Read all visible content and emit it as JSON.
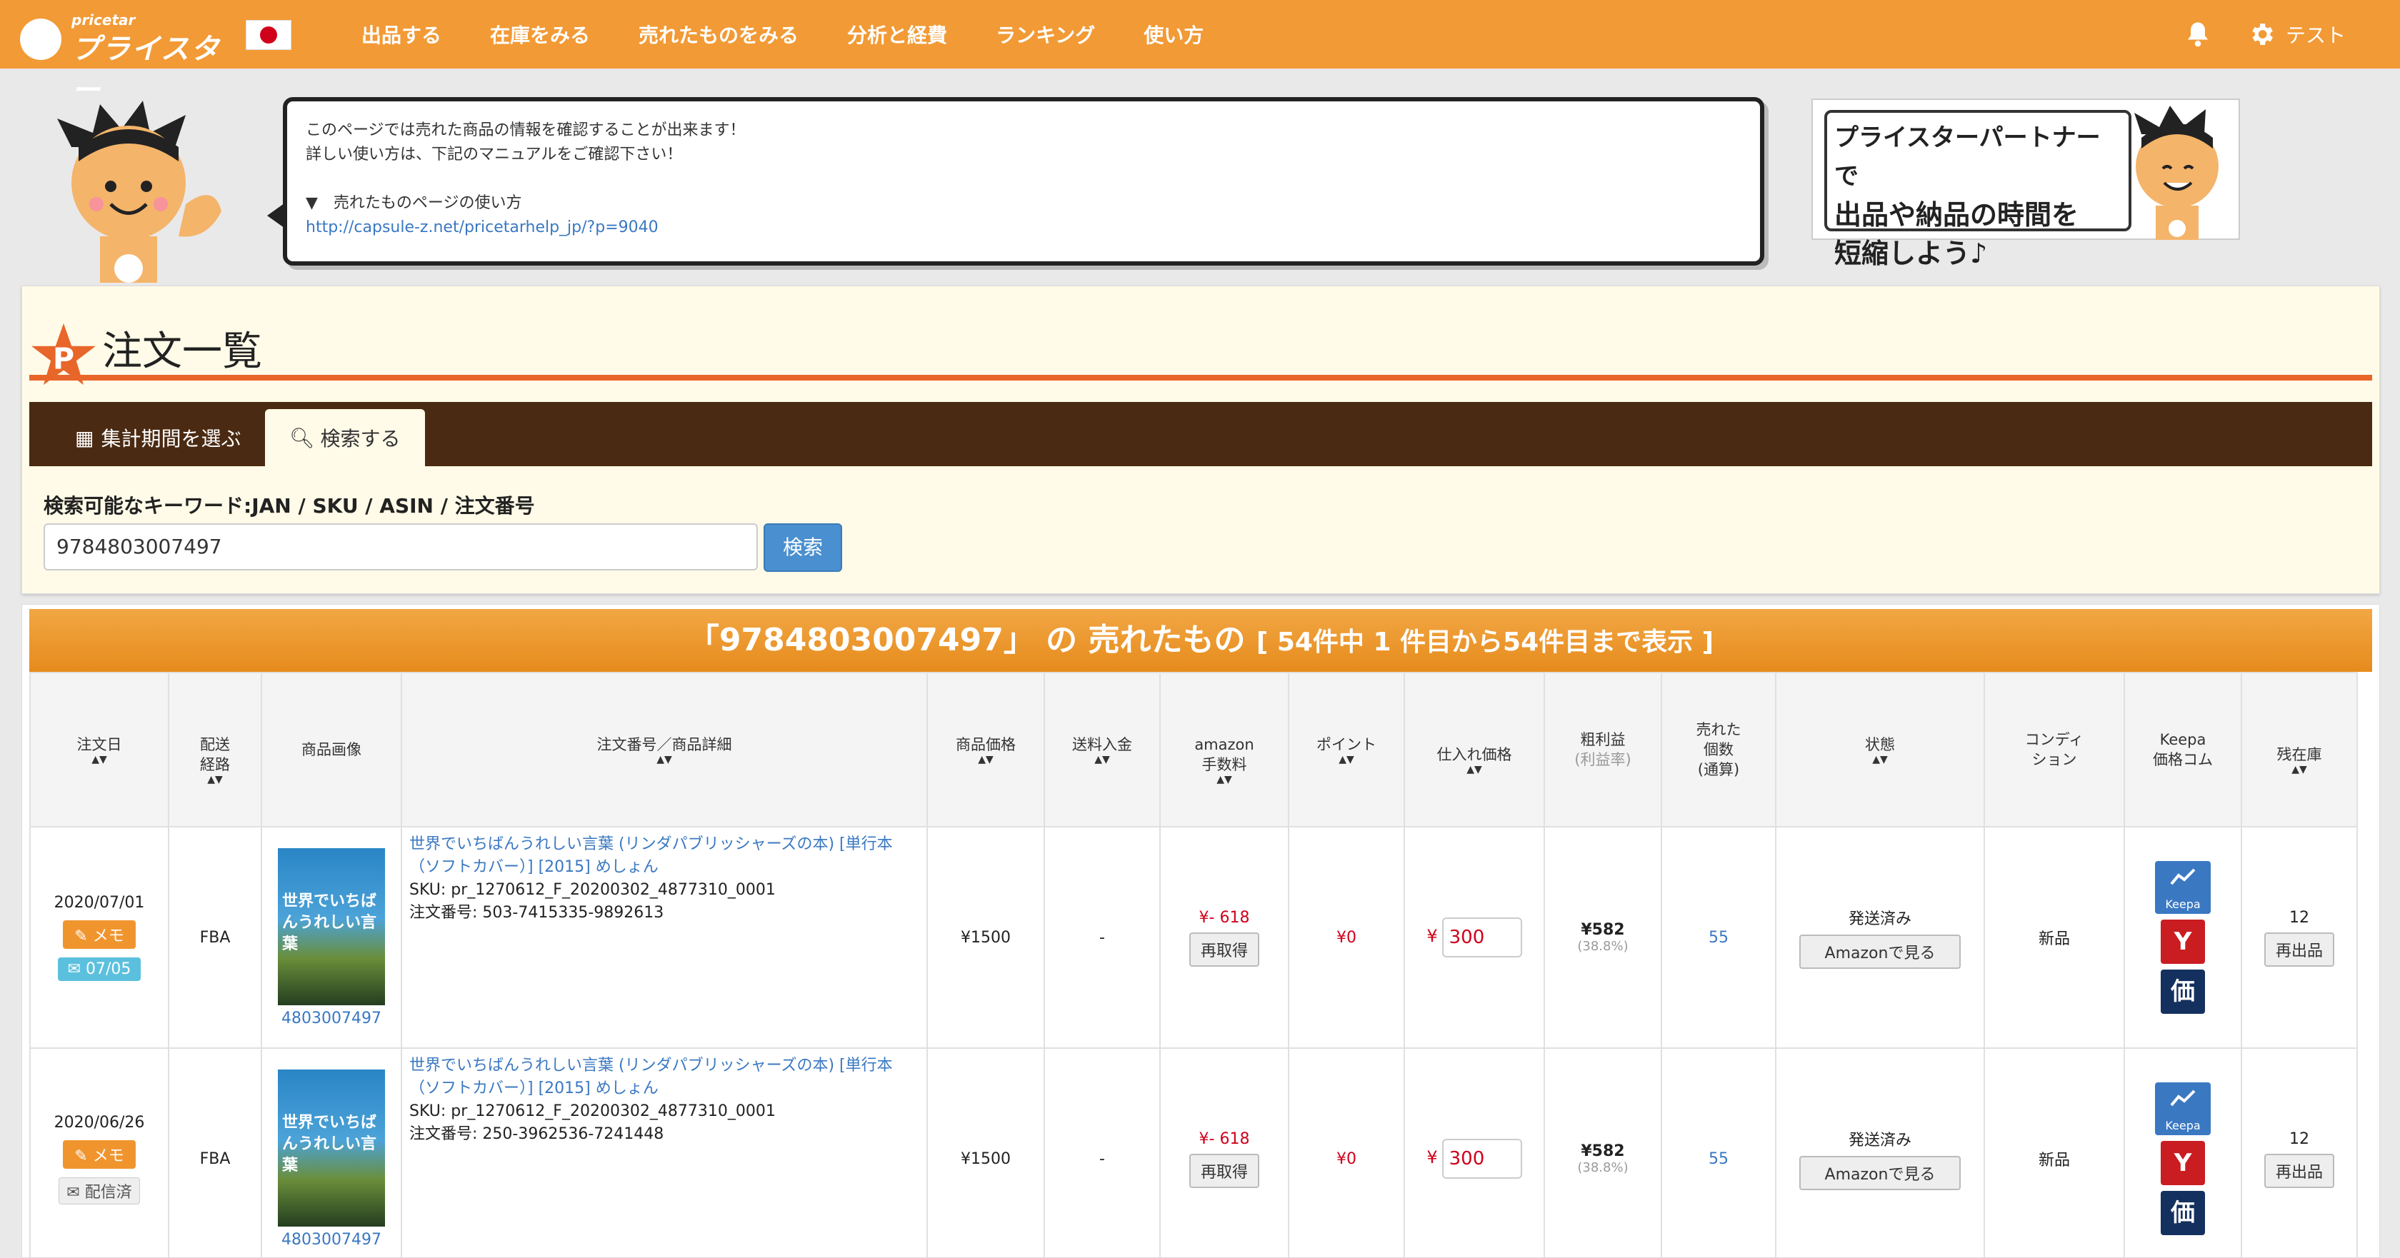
{
  "header": {
    "logo_small": "pricetar",
    "logo_main": "プライスター",
    "nav": [
      "出品する",
      "在庫をみる",
      "売れたものをみる",
      "分析と経費",
      "ランキング",
      "使い方"
    ],
    "user": "テスト"
  },
  "notice": {
    "line1": "このページでは売れた商品の情報を確認することが出来ます！",
    "line2": "詳しい使い方は、下記のマニュアルをご確認下さい！",
    "line3": "▼　売れたものページの使い方",
    "link": "http://capsule-z.net/pricetarhelp_jp/?p=9040"
  },
  "banner": {
    "line1": "プライスターパートナーで",
    "line2": "出品や納品の時間を",
    "line3": "短縮しよう♪"
  },
  "page": {
    "title": "注文一覧",
    "tab_period": "集計期間を選ぶ",
    "tab_search": "検索する",
    "keyword_label": "検索可能なキーワード:JAN / SKU / ASIN / 注文番号",
    "search_value": "9784803007497",
    "search_button": "検索"
  },
  "results": {
    "title": "「9784803007497」 の 売れたもの",
    "count": "[ 54件中 1 件目から54件目まで表示 ]"
  },
  "columns": {
    "date": "注文日",
    "route1": "配送",
    "route2": "経路",
    "image": "商品画像",
    "detail": "注文番号／商品詳細",
    "price": "商品価格",
    "shipping": "送料入金",
    "fee1": "amazon",
    "fee2": "手数料",
    "point": "ポイント",
    "cost": "仕入れ価格",
    "profit1": "粗利益",
    "profit2": "(利益率)",
    "sold1": "売れた",
    "sold2": "個数",
    "sold3": "(通算)",
    "status": "状態",
    "cond1": "コンディ",
    "cond2": "ション",
    "keepa1": "Keepa",
    "keepa2": "価格コム",
    "stock": "残在庫"
  },
  "rows": [
    {
      "date": "2020/07/01",
      "memo": "メモ",
      "ship_badge": "07/05",
      "route": "FBA",
      "cover": "世界でいちばんうれしい言葉",
      "asin": "4803007497",
      "title": "世界でいちばんうれしい言葉 (リンダパブリッシャーズの本) [単行本（ソフトカバー）] [2015] めしょん",
      "sku": "SKU: pr_1270612_F_20200302_4877310_0001",
      "order": "注文番号: 503-7415335-9892613",
      "price": "¥1500",
      "shipping": "-",
      "fee": "¥- 618",
      "refetch": "再取得",
      "point": "¥0",
      "cost_yen": "¥",
      "cost": "300",
      "profit": "¥582",
      "rate": "(38.8%)",
      "sold": "55",
      "status": "発送済み",
      "amazon_btn": "Amazonで見る",
      "condition": "新品",
      "keepa": "Keepa",
      "y": "Y",
      "kakaku": "価",
      "stock": "12",
      "relist": "再出品"
    },
    {
      "date": "2020/06/26",
      "memo": "メモ",
      "ship_badge": "配信済",
      "route": "FBA",
      "cover": "世界でいちばんうれしい言葉",
      "asin": "4803007497",
      "title": "世界でいちばんうれしい言葉 (リンダパブリッシャーズの本) [単行本（ソフトカバー）] [2015] めしょん",
      "sku": "SKU: pr_1270612_F_20200302_4877310_0001",
      "order": "注文番号: 250-3962536-7241448",
      "price": "¥1500",
      "shipping": "-",
      "fee": "¥- 618",
      "refetch": "再取得",
      "point": "¥0",
      "cost_yen": "¥",
      "cost": "300",
      "profit": "¥582",
      "rate": "(38.8%)",
      "sold": "55",
      "status": "発送済み",
      "amazon_btn": "Amazonで見る",
      "condition": "新品",
      "keepa": "Keepa",
      "y": "Y",
      "kakaku": "価",
      "stock": "12",
      "relist": "再出品"
    }
  ]
}
